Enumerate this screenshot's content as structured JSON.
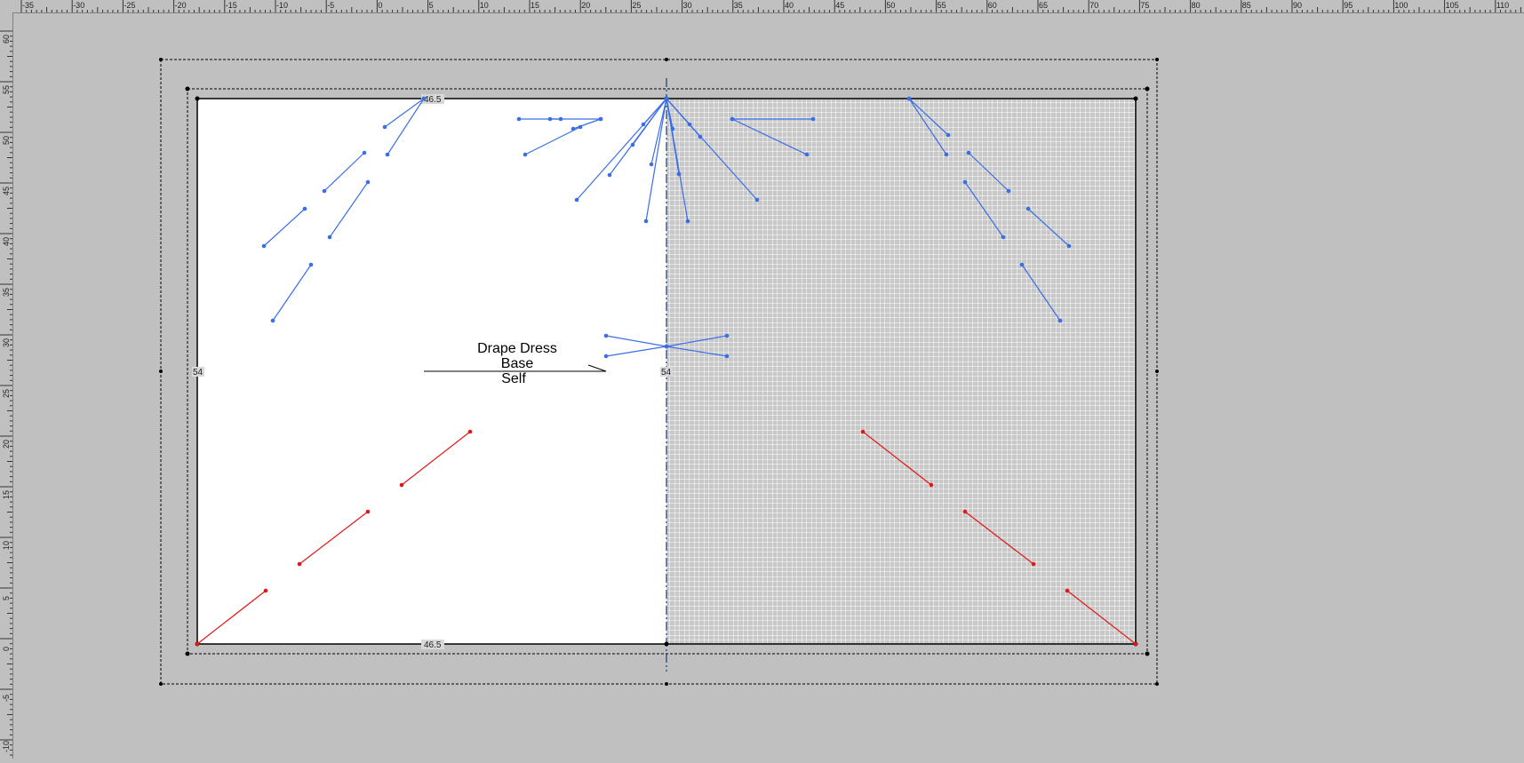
{
  "ruler_top": {
    "labels": [
      "-35",
      "-30",
      "-25",
      "-20",
      "-15",
      "-10",
      "-5",
      "0",
      "5",
      "10",
      "15",
      "20",
      "25",
      "30",
      "35",
      "40",
      "45",
      "50",
      "55",
      "60",
      "65",
      "70",
      "75",
      "80",
      "85",
      "90",
      "95",
      "100",
      "105",
      "110"
    ]
  },
  "ruler_left": {
    "labels": [
      "60",
      "55",
      "50",
      "45",
      "40",
      "35",
      "30",
      "25",
      "20",
      "15",
      "10",
      "5",
      "0",
      "-5",
      "-10"
    ]
  },
  "piece": {
    "label_lines": [
      "Drape Dress",
      "Base",
      "Self"
    ],
    "width_value": "46.5",
    "height_value": "54",
    "colors": {
      "canvas": "#c0c0c0",
      "piece_fill": "#ffffff",
      "grid_fill": "#c8c8c8",
      "grid_line": "#ffffff",
      "blue_line": "#3a6ee8",
      "red_line": "#e01818",
      "outline": "#000000"
    }
  }
}
